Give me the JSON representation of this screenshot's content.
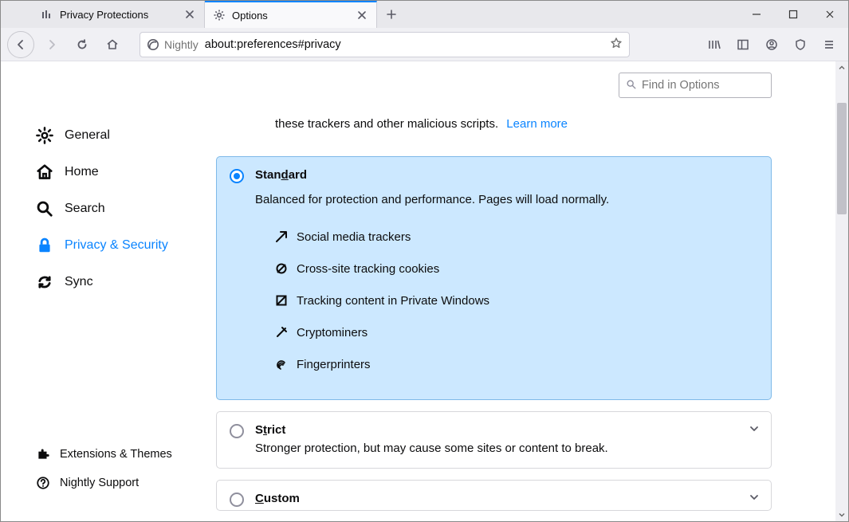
{
  "tabs": [
    {
      "title": "Privacy Protections",
      "icon": "shield-bars-icon",
      "active": false
    },
    {
      "title": "Options",
      "icon": "gear-icon",
      "active": true
    }
  ],
  "urlbar": {
    "identity_label": "Nightly",
    "url": "about:preferences#privacy"
  },
  "sidebar": {
    "items": [
      {
        "label": "General",
        "icon": "gear-icon"
      },
      {
        "label": "Home",
        "icon": "home-icon"
      },
      {
        "label": "Search",
        "icon": "search-icon"
      },
      {
        "label": "Privacy & Security",
        "icon": "lock-icon"
      },
      {
        "label": "Sync",
        "icon": "sync-icon"
      }
    ],
    "footer": [
      {
        "label": "Extensions & Themes",
        "icon": "puzzle-icon"
      },
      {
        "label": "Nightly Support",
        "icon": "help-icon"
      }
    ]
  },
  "search": {
    "placeholder": "Find in Options"
  },
  "intro": {
    "text_fragment": "these trackers and other malicious scripts.",
    "learn_more": "Learn more"
  },
  "options": {
    "standard": {
      "title_pre": "Stan",
      "title_ul": "d",
      "title_post": "ard",
      "desc": "Balanced for protection and performance. Pages will load normally.",
      "trackers": [
        "Social media trackers",
        "Cross-site tracking cookies",
        "Tracking content in Private Windows",
        "Cryptominers",
        "Fingerprinters"
      ]
    },
    "strict": {
      "title_pre": "S",
      "title_ul": "t",
      "title_post": "rict",
      "desc": "Stronger protection, but may cause some sites or content to break."
    },
    "custom": {
      "title_pre": "",
      "title_ul": "C",
      "title_post": "ustom"
    }
  }
}
